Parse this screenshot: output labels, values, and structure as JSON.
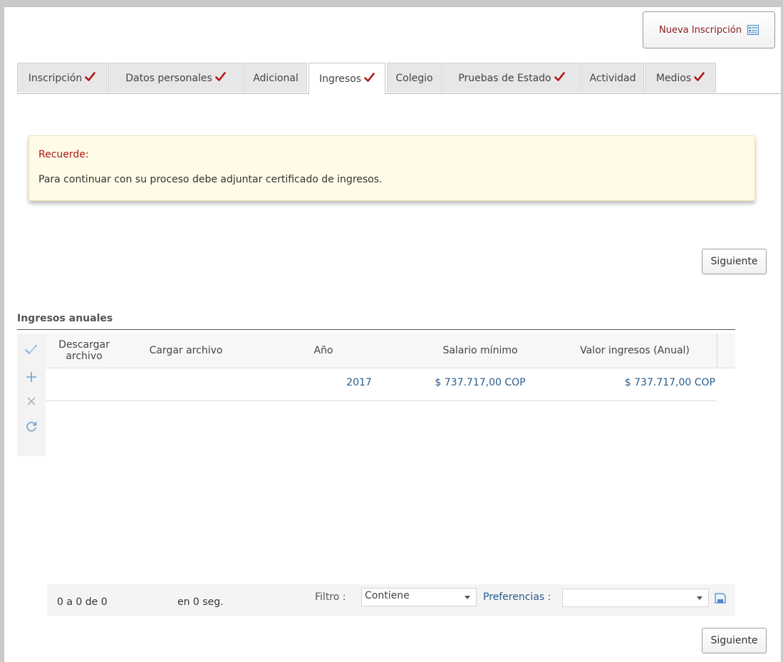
{
  "header": {
    "new_inscription_label": "Nueva Inscripción"
  },
  "tabs": [
    {
      "label": "Inscripción",
      "checked": true
    },
    {
      "label": "Datos personales",
      "checked": true
    },
    {
      "label": "Adicional",
      "checked": false
    },
    {
      "label": "Ingresos",
      "checked": true,
      "active": true
    },
    {
      "label": "Colegio",
      "checked": false
    },
    {
      "label": "Pruebas de Estado",
      "checked": true
    },
    {
      "label": "Actividad",
      "checked": false
    },
    {
      "label": "Medios",
      "checked": true
    }
  ],
  "alert": {
    "title": "Recuerde:",
    "message": "Para continuar con su proceso debe adjuntar certificado de ingresos."
  },
  "buttons": {
    "next_label": "Siguiente"
  },
  "grid": {
    "title": "Ingresos anuales",
    "columns": [
      "Descargar archivo",
      "Cargar archivo",
      "Año",
      "Salario mínimo",
      "Valor ingresos (Anual)"
    ],
    "rows": [
      {
        "descargar": "",
        "cargar": "",
        "anio": "2017",
        "salario": "$ 737.717,00 COP",
        "valor": "$ 737.717,00 COP"
      }
    ]
  },
  "footer": {
    "record_count": "0 a 0 de 0",
    "elapsed": "en 0 seg.",
    "filter_label": "Filtro :",
    "filter_value": "Contiene",
    "preferences_label": "Preferencias :",
    "preferences_value": ""
  },
  "colors": {
    "check_red": "#b01515",
    "link_blue": "#2a5c8a",
    "alert_bg": "#fffbe6"
  }
}
